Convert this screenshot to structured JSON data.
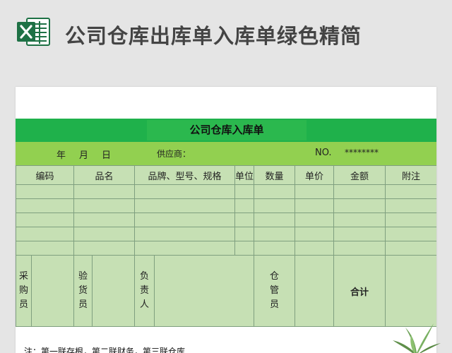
{
  "header": {
    "app_icon": "excel-icon",
    "title": "公司仓库出库单入库单绿色精简"
  },
  "form": {
    "title": "公司仓库入库单",
    "date_year": "年",
    "date_month": "月",
    "date_day": "日",
    "supplier_label": "供应商：",
    "no_label": "NO.",
    "no_value": "********"
  },
  "table": {
    "columns": [
      "编码",
      "品名",
      "品牌、型号、规格",
      "单位",
      "数量",
      "单价",
      "金额",
      "附注"
    ],
    "empty_rows": 5,
    "signatures": {
      "purchaser": "采购员",
      "inspector": "验货员",
      "manager": "负责人",
      "warehouse_keeper": "仓管员",
      "total": "合计"
    }
  },
  "footer": {
    "note": "注：第一联存根，第二联财务，第三联仓库"
  },
  "colors": {
    "title_band": "#1fb14b",
    "meta_band": "#92d050",
    "table_fill": "#c6e0b4",
    "excel_green": "#1e7145"
  }
}
